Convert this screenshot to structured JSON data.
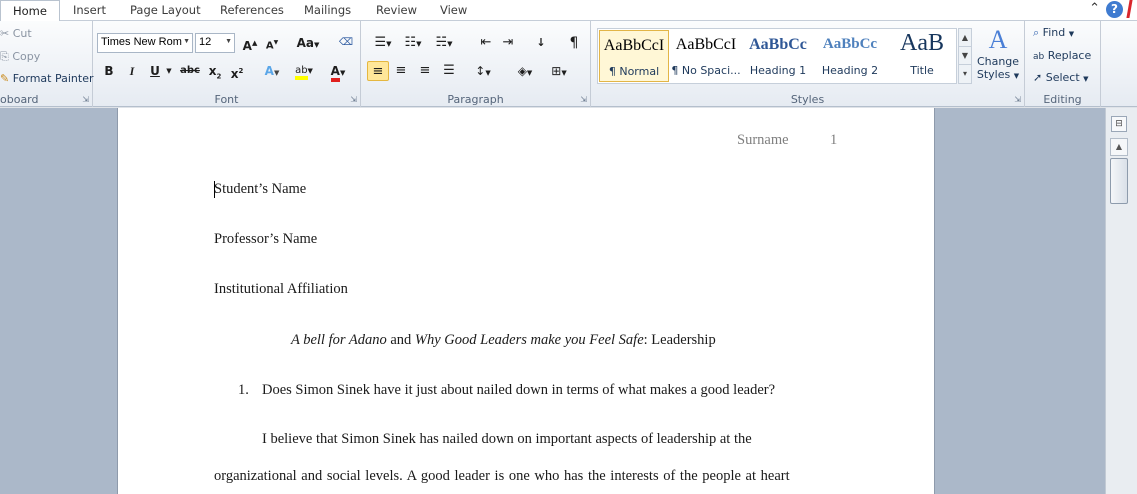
{
  "tabs": [
    "Home",
    "Insert",
    "Page Layout",
    "References",
    "Mailings",
    "Review",
    "View"
  ],
  "clipboard": {
    "cut": "Cut",
    "copy": "Copy",
    "format_painter": "Format Painter",
    "label": "oboard"
  },
  "font": {
    "name": "Times New Rom",
    "size": "12",
    "label": "Font",
    "grow": "A",
    "shrink": "A",
    "change_case": "Aa",
    "bold": "B",
    "italic": "I",
    "underline": "U",
    "strike": "abc",
    "subscript": "x",
    "superscript": "x",
    "text_effects": "A",
    "highlight": "ab",
    "font_color": "A"
  },
  "paragraph": {
    "label": "Paragraph",
    "pilcrow": "¶"
  },
  "styles": {
    "label": "Styles",
    "items": [
      {
        "preview": "AaBbCcI",
        "name": "¶ Normal"
      },
      {
        "preview": "AaBbCcI",
        "name": "¶ No Spaci..."
      },
      {
        "preview": "AaBbCc",
        "name": "Heading 1"
      },
      {
        "preview": "AaBbCc",
        "name": "Heading 2"
      },
      {
        "preview": "AaB",
        "name": "Title"
      }
    ],
    "change_styles_line1": "Change",
    "change_styles_line2": "Styles"
  },
  "editing": {
    "label": "Editing",
    "find": "Find",
    "replace": "Replace",
    "select": "Select"
  },
  "document": {
    "header_surname": "Surname",
    "header_page": "1",
    "student_name": "Student’s Name",
    "professor_name": "Professor’s Name",
    "affiliation": "Institutional Affiliation",
    "title_italic1": "A bell for Adano",
    "title_and": " and ",
    "title_italic2": "Why Good Leaders make you Feel Safe",
    "title_rest": ": Leadership",
    "list_number": "1.",
    "question": "Does Simon Sinek have it just about nailed down in terms of what makes a good leader?",
    "para_line1": "I believe that Simon Sinek has nailed down on important aspects of leadership at the",
    "para_line2": "organizational and social levels. A good leader is one who has the interests of the people at heart"
  },
  "colors": {
    "accent": "#ffe79a",
    "workspace": "#abb8c9",
    "ribbon_text": "#1e395b"
  }
}
